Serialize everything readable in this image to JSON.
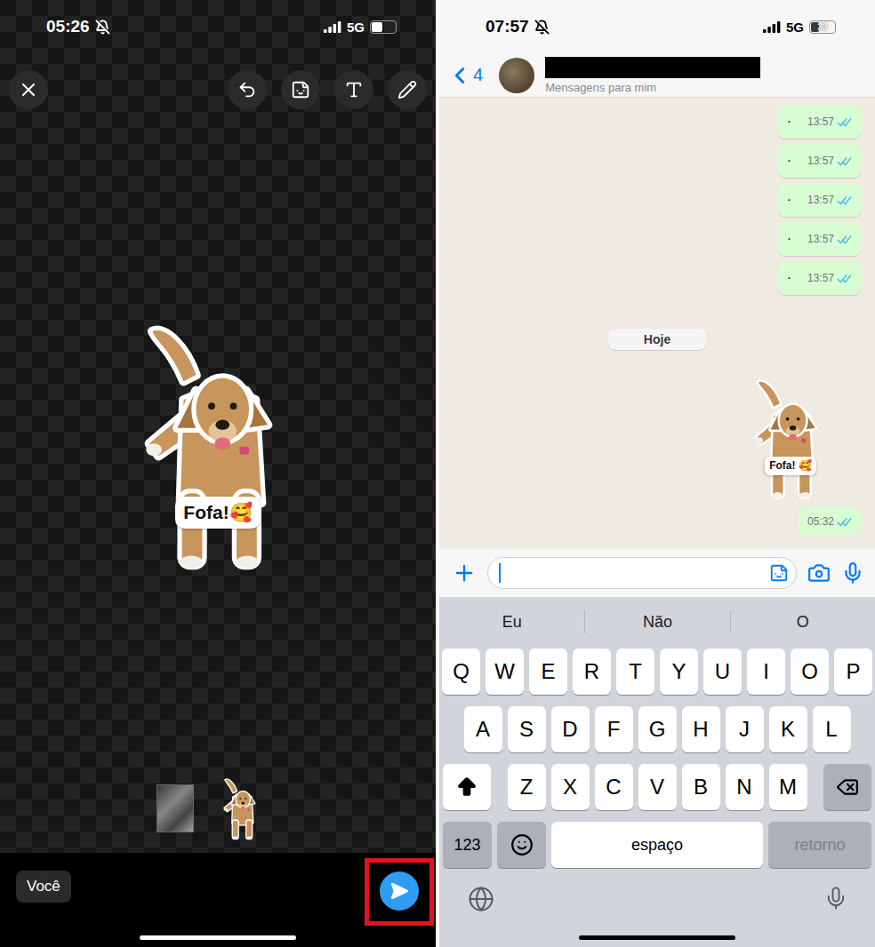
{
  "editor": {
    "status_bar": {
      "time": "05:26",
      "network": "5G",
      "battery_level": 0.45
    },
    "sticker": {
      "caption": "Fofa!🥰"
    },
    "thumbnails": [
      {
        "kind": "photo",
        "selected": false
      },
      {
        "kind": "sticker",
        "selected": true
      }
    ],
    "recipient": "Você",
    "send_button": {
      "highlighted": true
    }
  },
  "chat": {
    "status_bar": {
      "time": "07:57",
      "network": "5G",
      "battery": "33",
      "battery_level": 0.33
    },
    "header": {
      "back_count": "4",
      "name_redacted": true,
      "subtitle": "Mensagens para mim"
    },
    "messages": [
      {
        "text": "·",
        "time": "13:57",
        "read": true
      },
      {
        "text": "·",
        "time": "13:57",
        "read": true
      },
      {
        "text": "·",
        "time": "13:57",
        "read": true
      },
      {
        "text": "·",
        "time": "13:57",
        "read": true
      },
      {
        "text": "·",
        "time": "13:57",
        "read": true
      }
    ],
    "date_chip": "Hoje",
    "sticker_message": {
      "caption": "Fofa! 🥰",
      "time": "05:32",
      "read": true
    },
    "suggestions": [
      "Eu",
      "Não",
      "O"
    ],
    "keyboard": {
      "rows": [
        [
          "Q",
          "W",
          "E",
          "R",
          "T",
          "Y",
          "U",
          "I",
          "O",
          "P"
        ],
        [
          "A",
          "S",
          "D",
          "F",
          "G",
          "H",
          "J",
          "K",
          "L"
        ],
        [
          "Z",
          "X",
          "C",
          "V",
          "B",
          "N",
          "M"
        ]
      ],
      "numbers_key": "123",
      "space_key": "espaço",
      "return_key": "retorno",
      "return_enabled": false
    }
  }
}
